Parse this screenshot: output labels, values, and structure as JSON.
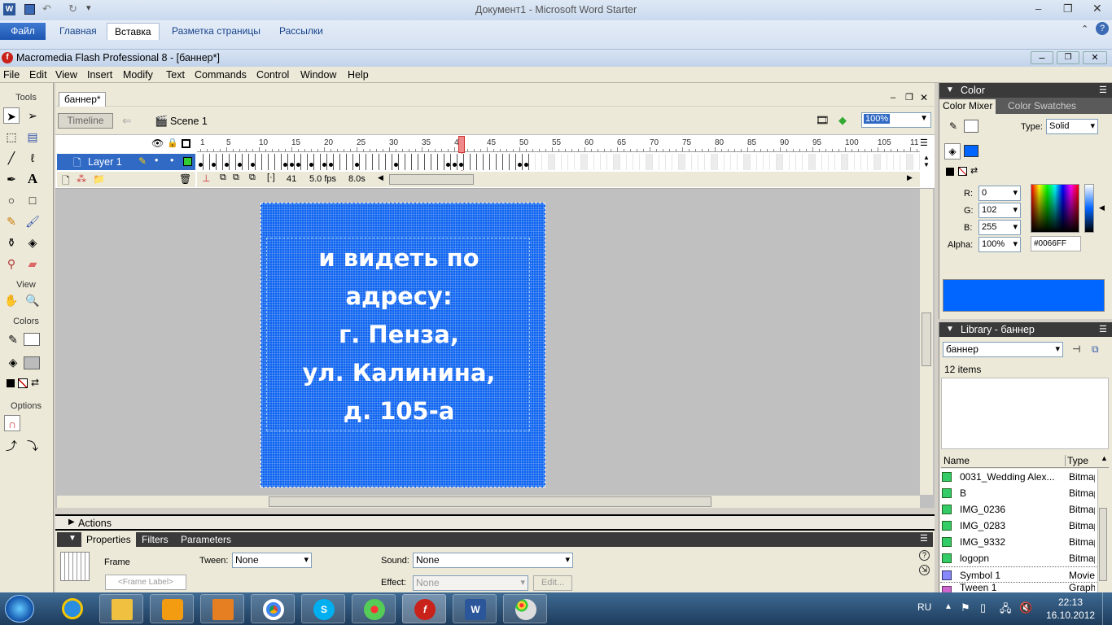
{
  "word": {
    "title": "Документ1  -  Microsoft Word Starter",
    "tabs": [
      "Файл",
      "Главная",
      "Вставка",
      "Разметка страницы",
      "Рассылки"
    ]
  },
  "flash": {
    "title": "Macromedia Flash Professional 8 - [баннер*]",
    "menu": [
      "File",
      "Edit",
      "View",
      "Insert",
      "Modify",
      "Text",
      "Commands",
      "Control",
      "Window",
      "Help"
    ],
    "tools": {
      "header": "Tools",
      "view_header": "View",
      "colors_header": "Colors",
      "options_header": "Options"
    },
    "document_tab": "баннер*",
    "timeline": {
      "button": "Timeline",
      "scene": "Scene 1",
      "zoom": "100%",
      "layer_name": "Layer 1",
      "ruler_ticks": [
        "1",
        "5",
        "10",
        "15",
        "20",
        "25",
        "30",
        "35",
        "40",
        "45",
        "50",
        "55",
        "60",
        "65",
        "70",
        "75",
        "80",
        "85",
        "90",
        "95",
        "100",
        "105",
        "11"
      ],
      "current_frame": "41",
      "fps": "5.0 fps",
      "time": "8.0s"
    },
    "stage_text": [
      "и видеть по",
      "адресу:",
      "г. Пенза,",
      "ул. Калинина,",
      "д. 105-а"
    ],
    "actions_label": "Actions",
    "properties": {
      "tabs": [
        "Properties",
        "Filters",
        "Parameters"
      ],
      "frame_label": "Frame",
      "frame_label_placeholder": "<Frame Label>",
      "tween_label": "Tween:",
      "tween_value": "None",
      "sound_label": "Sound:",
      "sound_value": "None",
      "effect_label": "Effect:",
      "effect_value": "None",
      "edit_button": "Edit..."
    },
    "color_panel": {
      "title": "Color",
      "tab_mixer": "Color Mixer",
      "tab_swatches": "Color Swatches",
      "type_label": "Type:",
      "type_value": "Solid",
      "r_label": "R:",
      "r_value": "0",
      "g_label": "G:",
      "g_value": "102",
      "b_label": "B:",
      "b_value": "255",
      "alpha_label": "Alpha:",
      "alpha_value": "100%",
      "hex_value": "#0066FF",
      "fill_color": "#0066ff"
    },
    "library": {
      "title": "Library - баннер",
      "selector": "баннер",
      "count": "12 items",
      "col_name": "Name",
      "col_type": "Type",
      "items": [
        {
          "name": "0031_Wedding Alex...",
          "type": "Bitmap"
        },
        {
          "name": "B",
          "type": "Bitmap"
        },
        {
          "name": "IMG_0236",
          "type": "Bitmap"
        },
        {
          "name": "IMG_0283",
          "type": "Bitmap"
        },
        {
          "name": "IMG_9332",
          "type": "Bitmap"
        },
        {
          "name": "logopn",
          "type": "Bitmap"
        },
        {
          "name": "Symbol 1",
          "type": "Movie"
        },
        {
          "name": "Tween 1",
          "type": "Graph"
        }
      ]
    }
  },
  "taskbar": {
    "lang": "RU",
    "time": "22:13",
    "date": "16.10.2012"
  }
}
